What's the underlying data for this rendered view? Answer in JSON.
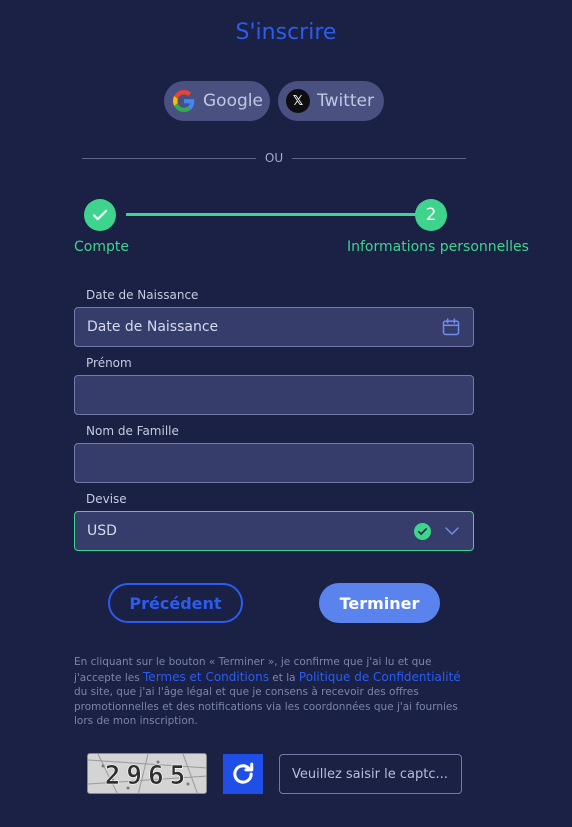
{
  "page": {
    "title": "S'inscrire"
  },
  "social": {
    "google_label": "Google",
    "twitter_label": "Twitter"
  },
  "divider": {
    "text": "OU"
  },
  "steps": [
    {
      "label": "Compte",
      "status": "completed",
      "icon": "check-icon"
    },
    {
      "label": "Informations personnelles",
      "number": "2",
      "status": "active"
    }
  ],
  "form": {
    "birthdate": {
      "label": "Date de Naissance",
      "placeholder": "Date de Naissance",
      "icon": "calendar-icon"
    },
    "first_name": {
      "label": "Prénom",
      "value": ""
    },
    "last_name": {
      "label": "Nom de Famille",
      "value": ""
    },
    "currency": {
      "label": "Devise",
      "value": "USD",
      "state": "valid"
    }
  },
  "buttons": {
    "previous": "Précédent",
    "finish": "Terminer"
  },
  "terms": {
    "part1": "En cliquant sur le bouton « Terminer », je confirme que j'ai lu et que j'accepte les ",
    "link1": "Termes et Conditions",
    "part2": " et la ",
    "link2": "Politique de Confidentialité",
    "part3": " du site, que j'ai l'âge légal et que je consens à recevoir des offres promotionnelles et des notifications via les coordonnées que j'ai fournies lors de mon inscription."
  },
  "captcha": {
    "code": "2965",
    "placeholder": "Veuillez saisir le captc..."
  },
  "colors": {
    "background": "#1a2144",
    "accent_blue": "#2b5cf2",
    "success_green": "#3fd48d",
    "button_blue": "#5b83ee"
  }
}
